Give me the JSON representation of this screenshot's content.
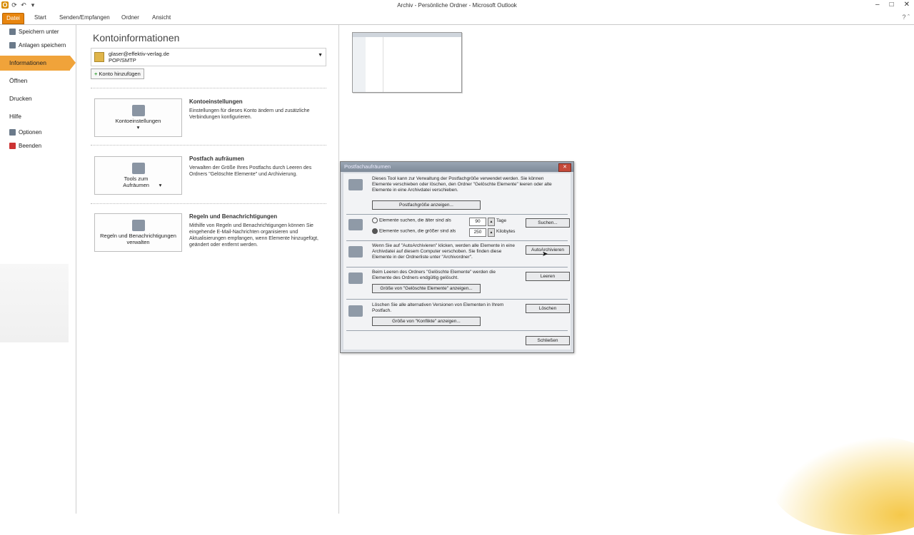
{
  "window": {
    "title": "Archiv - Persönliche Ordner - Microsoft Outlook"
  },
  "tabs": [
    "Datei",
    "Start",
    "Senden/Empfangen",
    "Ordner",
    "Ansicht"
  ],
  "sidebar": {
    "save_as": "Speichern unter",
    "save_attachments": "Anlagen speichern",
    "info": "Informationen",
    "open": "Öffnen",
    "print": "Drucken",
    "help": "Hilfe",
    "options": "Optionen",
    "exit": "Beenden"
  },
  "main": {
    "title": "Kontoinformationen",
    "account_email": "glaser@effektiv-verlag.de",
    "account_type": "POP/SMTP",
    "add_account": "Konto hinzufügen",
    "sections": [
      {
        "button": "Kontoeinstellungen",
        "title": "Kontoeinstellungen",
        "desc": "Einstellungen für dieses Konto ändern und zusätzliche Verbindungen konfigurieren."
      },
      {
        "button": "Tools zum Aufräumen",
        "title": "Postfach aufräumen",
        "desc": "Verwalten der Größe Ihres Postfachs durch Leeren des Ordners \"Gelöschte Elemente\" und Archivierung."
      },
      {
        "button": "Regeln und Benachrichtigungen verwalten",
        "title": "Regeln und Benachrichtigungen",
        "desc": "Mithilfe von Regeln und Benachrichtigungen können Sie eingehende E-Mail-Nachrichten organisieren und Aktualisierungen empfangen, wenn Elemente hinzugefügt, geändert oder entfernt werden."
      }
    ]
  },
  "dialog": {
    "title": "Postfachaufräumen",
    "intro": "Dieses Tool kann zur Verwaltung der Postfachgröße verwendet werden. Sie können Elemente verschieben oder löschen, den Ordner \"Gelöschte Elemente\" leeren oder alte Elemente in eine Archivdatei verschieben.",
    "size_btn": "Postfachgröße anzeigen...",
    "opt_older": "Elemente suchen, die älter sind als",
    "older_value": "90",
    "older_unit": "Tage",
    "opt_larger": "Elemente suchen, die größer sind als",
    "larger_value": "250",
    "larger_unit": "Kilobytes",
    "find_btn": "Suchen...",
    "autoarchive_text": "Wenn Sie auf \"AutoArchivieren\" klicken, werden alle Elemente in eine Archivdatei auf diesem Computer verschoben. Sie finden diese Elemente in der Ordnerliste unter \"Archivordner\".",
    "autoarchive_btn": "AutoArchivieren",
    "deleted_text": "Beim Leeren des Ordners \"Gelöschte Elemente\" werden die Elemente des Ordners endgültig gelöscht.",
    "empty_btn": "Leeren",
    "deleted_size_btn": "Größe von \"Gelöschte Elemente\" anzeigen...",
    "conflicts_text": "Löschen Sie alle alternativen Versionen von Elementen in Ihrem Postfach.",
    "delete_btn": "Löschen",
    "conflicts_btn": "Größe von \"Konflikte\" anzeigen...",
    "close_btn": "Schließen"
  }
}
